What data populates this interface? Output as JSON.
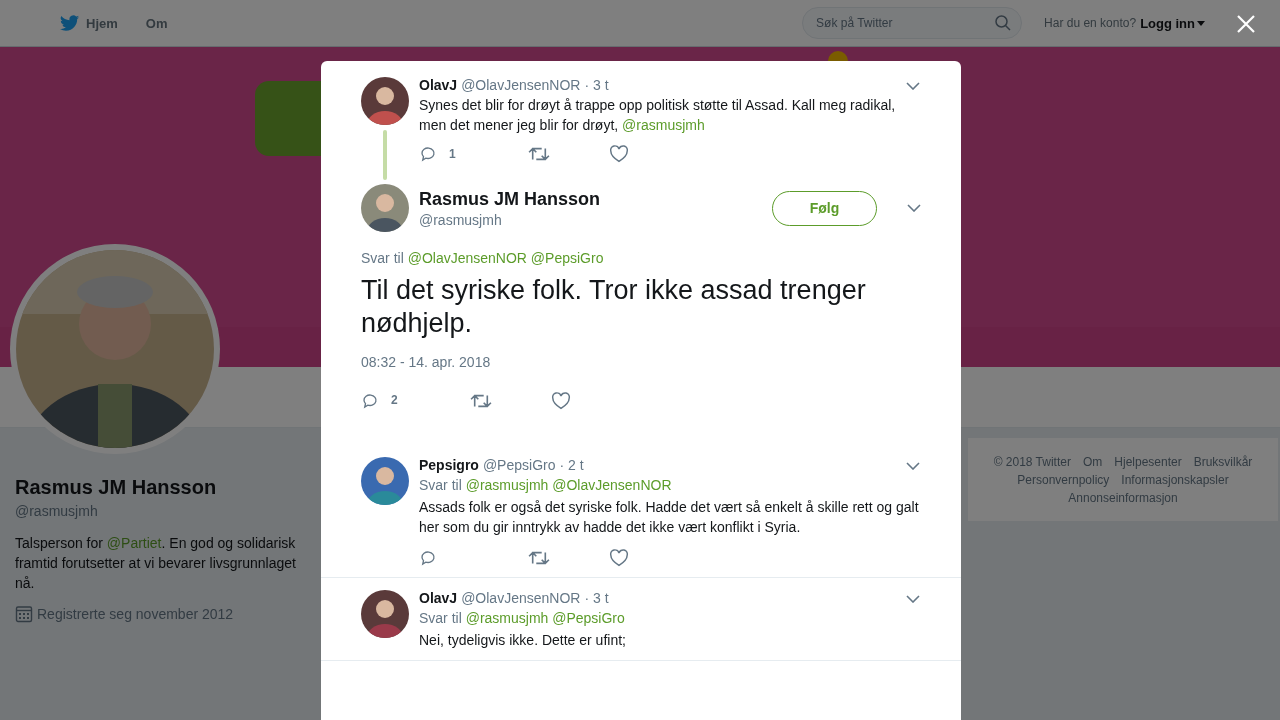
{
  "topbar": {
    "nav": [
      "Hjem",
      "Om"
    ],
    "search": {
      "placeholder": "Søk på Twitter"
    },
    "account_prompt": "Har du en konto?",
    "login": "Logg inn"
  },
  "profile": {
    "name": "Rasmus JM Hansson",
    "handle": "@rasmusjmh",
    "bio": [
      {
        "kind": "text",
        "text": "Talsperson for "
      },
      {
        "kind": "mention",
        "text": "@Partiet"
      },
      {
        "kind": "text",
        "text": ". En god og solidarisk framtid forutsetter at vi bevarer livsgrunnlaget nå."
      }
    ],
    "joined": "Registrerte seg november 2012"
  },
  "footer": [
    "© 2018 Twitter",
    "Om",
    "Hjelpesenter",
    "Bruksvilkår",
    "Personvernpolicy",
    "Informasjonskapsler",
    "Annonseinformasjon"
  ],
  "modal": {
    "parent": {
      "name": "OlavJ",
      "handle": "@OlavJensenNOR",
      "time": "· 3 t",
      "text": [
        {
          "kind": "text",
          "text": "Synes det blir for drøyt å trappe opp politisk støtte til Assad. Kall meg radikal, men det mener jeg blir for drøyt, "
        },
        {
          "kind": "mention",
          "text": "@rasmusjmh"
        }
      ],
      "reply_count": "1"
    },
    "main": {
      "name": "Rasmus JM Hansson",
      "handle": "@rasmusjmh",
      "follow": "Følg",
      "reply_prefix": "Svar til",
      "reply_to": [
        "@OlavJensenNOR",
        "@PepsiGro"
      ],
      "text": "Til det syriske folk. Tror ikke assad trenger nødhjelp.",
      "timestamp": "08:32 - 14. apr. 2018",
      "reply_count": "2"
    },
    "replies": [
      {
        "name": "Pepsigro",
        "handle": "@PepsiGro",
        "time": "· 2 t",
        "reply_prefix": "Svar til",
        "reply_to": [
          "@rasmusjmh",
          "@OlavJensenNOR"
        ],
        "text": "Assads folk er også det syriske folk. Hadde det vært så enkelt å skille rett og galt her som du gir inntrykk av hadde det ikke vært konflikt i Syria.",
        "actions": true
      },
      {
        "name": "OlavJ",
        "handle": "@OlavJensenNOR",
        "time": "· 3 t",
        "reply_prefix": "Svar til",
        "reply_to": [
          "@rasmusjmh",
          "@PepsiGro"
        ],
        "text": "Nei, tydeligvis ikke. Dette er ufint;",
        "actions": false
      }
    ]
  }
}
